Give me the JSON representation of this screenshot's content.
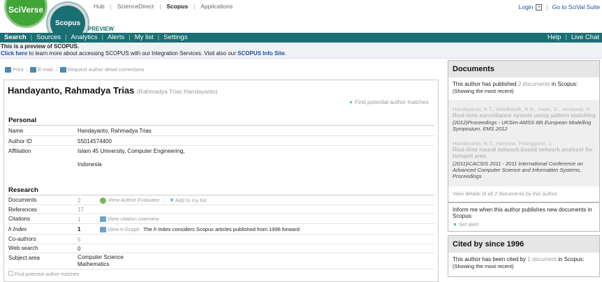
{
  "header": {
    "sciverse_logo": "SciVerse",
    "scopus_logo": "Scopus",
    "preview": "PREVIEW",
    "top_links": [
      "Hub",
      "ScienceDirect",
      "Scopus",
      "Applications"
    ],
    "login": "Login",
    "solval": "Go to SciVal Suite"
  },
  "nav": {
    "items": [
      "Search",
      "Sources",
      "Analytics",
      "Alerts",
      "My list",
      "Settings"
    ],
    "right": [
      "Help",
      "Live Chat"
    ]
  },
  "notice": {
    "line1": "This is a preview of SCOPUS.",
    "click_here": "Click here",
    "line2": " to learn more about accessing SCOPUS with our Integration Services. Visit also our ",
    "info_site": "SCOPUS Info Site",
    "end": "."
  },
  "actions": {
    "print": "Print",
    "email": "E-mail",
    "request": "Request author detail corrections"
  },
  "author": {
    "name": "Handayanto, Rahmadya Trias",
    "alt_name": "(Rahmadya Trias Handayanto)",
    "find_matches": "Find potential author matches"
  },
  "personal": {
    "title": "Personal",
    "rows": [
      {
        "label": "Name",
        "value": "Handayanto, Rahmadya Trias"
      },
      {
        "label": "Author ID",
        "value": "55014574400"
      },
      {
        "label": "Affiliation",
        "value": "Islam 45 University, Computer Engineering,"
      },
      {
        "label": "",
        "value": "Indonesia"
      }
    ]
  },
  "research": {
    "title": "Research",
    "documents": {
      "label": "Documents",
      "value": "2",
      "link1": "View Author Evaluator",
      "link2": "Add to my list"
    },
    "references": {
      "label": "References",
      "value": "17"
    },
    "citations": {
      "label": "Citations",
      "value": "1",
      "link": "View citation overview"
    },
    "hindex": {
      "label": "h Index",
      "value": "1",
      "link": "View h-Graph",
      "note_a": "The ",
      "note_h": "h",
      "note_b": " Index considers Scopus articles published from 1996 forward"
    },
    "coauthors": {
      "label": "Co-authors",
      "value": "5"
    },
    "websearch": {
      "label": "Web search",
      "value": "0"
    },
    "subject": {
      "label": "Subject area",
      "values": [
        "Computer Science",
        "Mathematics"
      ]
    },
    "find_bottom": "Find potential author matches"
  },
  "documents_panel": {
    "title": "Documents",
    "text_a": "This author has published ",
    "link": "2 documents",
    "text_b": " in Scopus:",
    "showing": "(Showing the most recent)",
    "docs": [
      {
        "authors": "Handayanto, R.T., Whidhiasih, R.N., Irwan, D., Herlawati, R.",
        "title": "Real-time surveillance system using pattern matching",
        "source": "(2012)Proceedings - UKSim-AMSS 6th European Modelling Symposium, EMS 2012"
      },
      {
        "authors": "Handayanto, R.T., Haryono, Prianggono, J.",
        "title": "Real-time neural network-based network analyzer for hotspot area",
        "source": "(2011)ICACSIS 2011 - 2011 International Conference on Advanced Computer Science and Information Systems, Proceedings"
      }
    ],
    "view_all": "View details of all 2 documents by this author"
  },
  "alert_panel": {
    "text": "Inform me when this author publishes new documents in Scopus:",
    "set_alert": "Set alert"
  },
  "cited_panel": {
    "title": "Cited by since 1996",
    "text_a": "This author has been cited by ",
    "link": "1 document",
    "text_b": " in Scopus:",
    "showing": "(Showing the most recent)"
  }
}
